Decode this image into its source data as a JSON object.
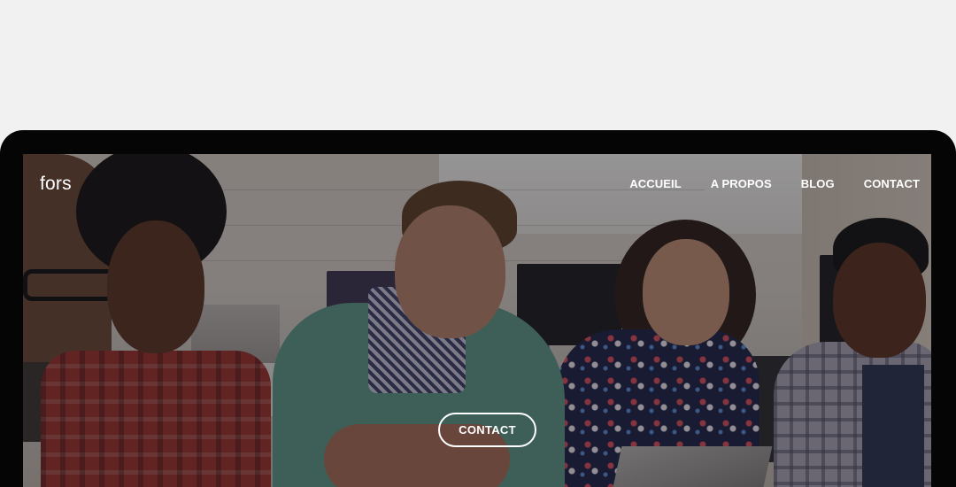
{
  "site": {
    "brand": "fors"
  },
  "nav": {
    "items": [
      {
        "label": "ACCUEIL"
      },
      {
        "label": "A PROPOS"
      },
      {
        "label": "BLOG"
      },
      {
        "label": "CONTACT"
      }
    ]
  },
  "hero": {
    "cta_label": "CONTACT",
    "image": "team-meeting-photo"
  },
  "colors": {
    "page_background": "#f1f1f1",
    "device_frame": "#050505",
    "nav_text": "#ffffff",
    "overlay": "rgba(20,20,24,0.42)"
  }
}
